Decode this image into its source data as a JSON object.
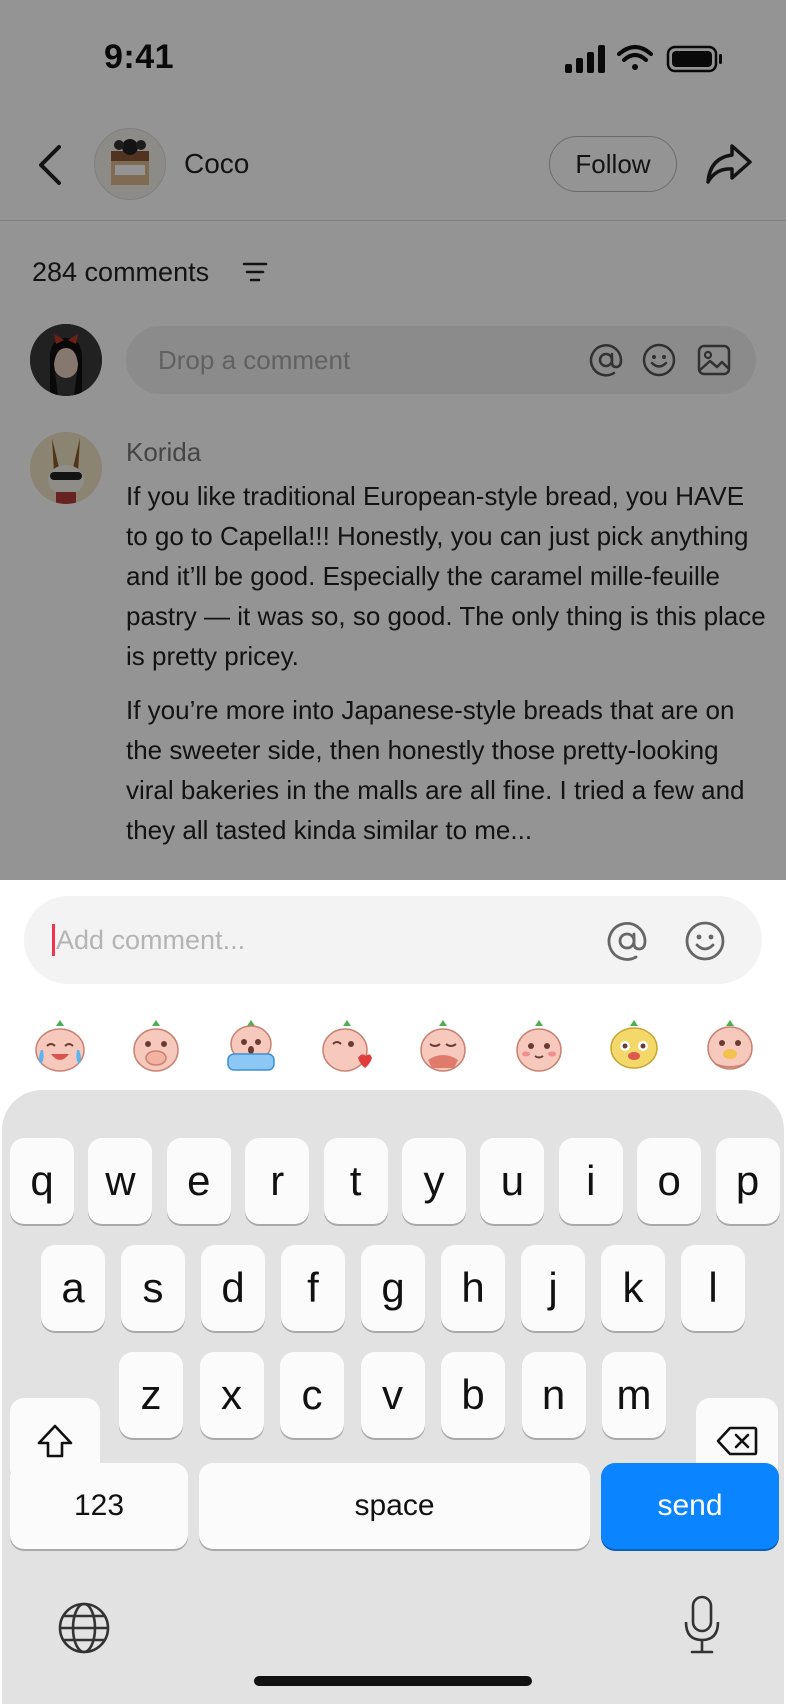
{
  "status_bar": {
    "time": "9:41"
  },
  "header": {
    "author": "Coco",
    "follow_label": "Follow"
  },
  "comments": {
    "count_label": "284 comments",
    "input_placeholder": "Drop a comment",
    "items": [
      {
        "user": "Korida",
        "paragraphs": [
          "If you like traditional European-style bread, you HAVE to go to Capella!!! Honestly, you can just pick anything and it’ll be good. Especially the caramel mille-feuille pastry — it was so, so good. The only thing is this place is pretty pricey.",
          "If you’re more into Japanese-style breads that are on the sweeter side, then honestly those pretty-looking viral bakeries in the malls are all fine. I tried a few and they all tasted kinda similar to me..."
        ]
      }
    ]
  },
  "composer": {
    "placeholder": "Add comment...",
    "value": "",
    "stickers": [
      "crying-laugh-sticker",
      "hand-on-mouth-sticker",
      "shocked-sticker",
      "kiss-heart-sticker",
      "facepalm-sticker",
      "blush-sticker",
      "puppy-sticker",
      "pleading-sticker"
    ]
  },
  "keyboard": {
    "row1": [
      "q",
      "w",
      "e",
      "r",
      "t",
      "y",
      "u",
      "i",
      "o",
      "p"
    ],
    "row2": [
      "a",
      "s",
      "d",
      "f",
      "g",
      "h",
      "j",
      "k",
      "l"
    ],
    "row3": [
      "z",
      "x",
      "c",
      "v",
      "b",
      "n",
      "m"
    ],
    "numbers_label": "123",
    "space_label": "space",
    "send_label": "send"
  },
  "colors": {
    "accent": "#0a84ff",
    "caret": "#f0334e",
    "dim_overlay": "rgba(0,0,0,0.42)"
  }
}
